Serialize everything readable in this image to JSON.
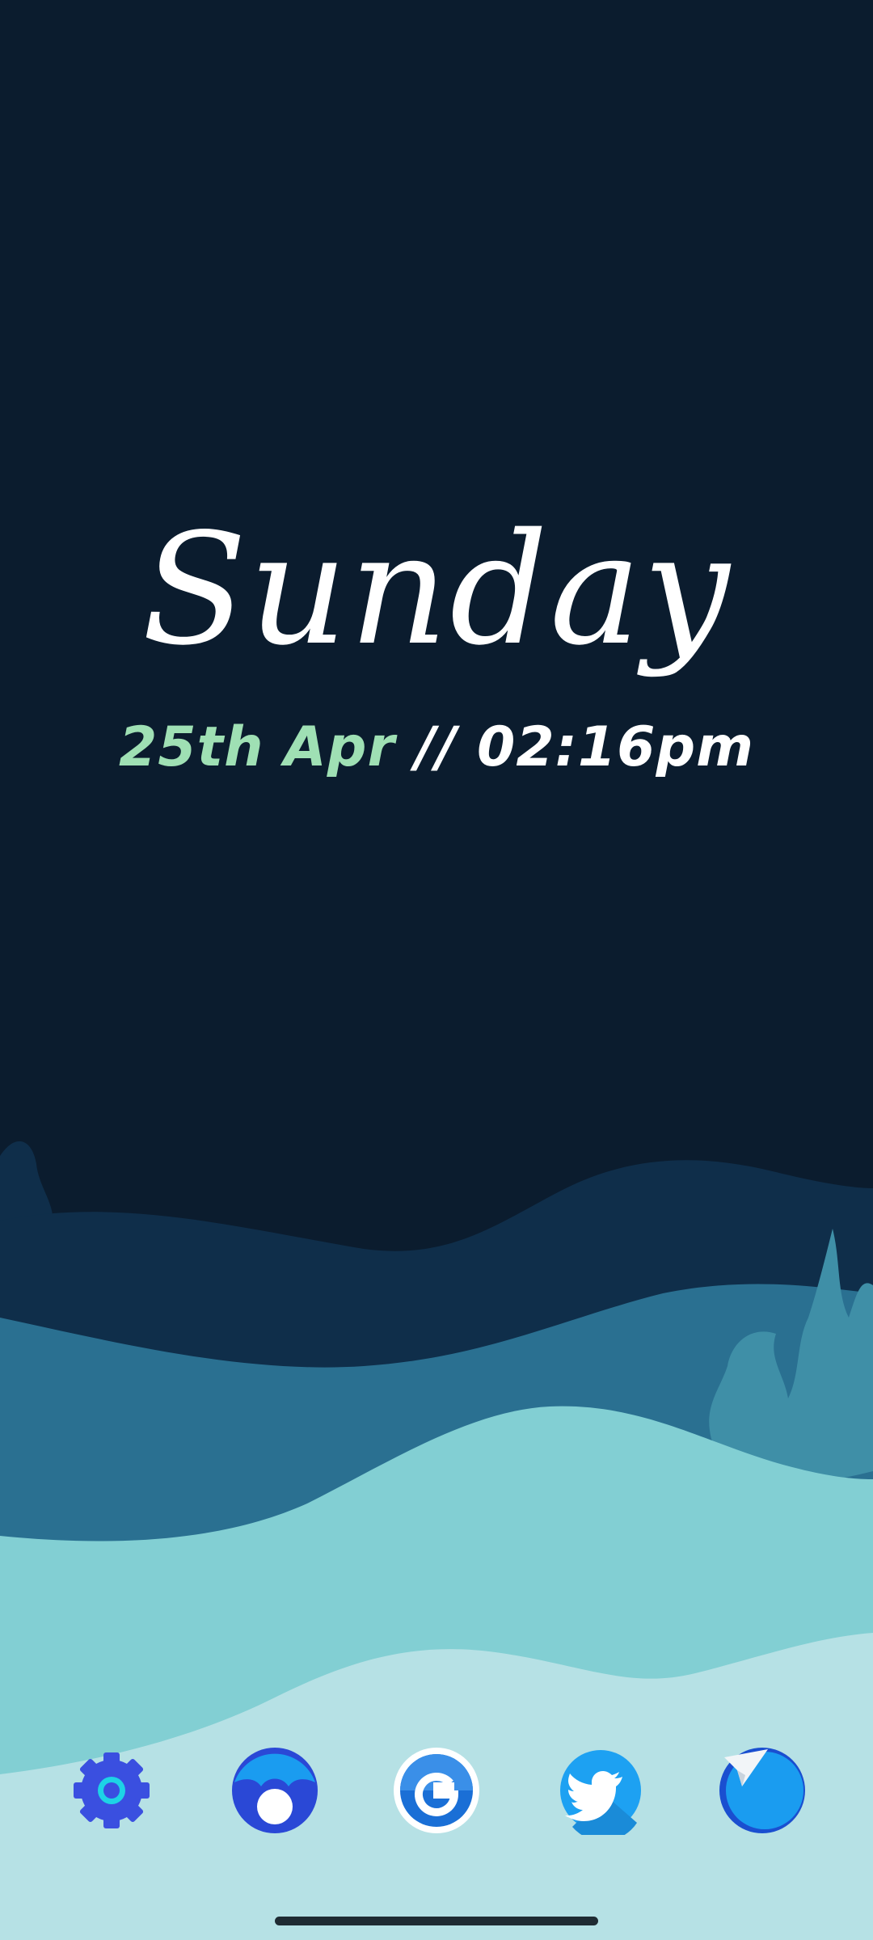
{
  "widget": {
    "day": "Sunday",
    "date": "25th Apr",
    "separator": " // ",
    "time": "02:16pm"
  },
  "dock": {
    "apps": [
      {
        "icon": "settings-gear-icon"
      },
      {
        "icon": "camera-icon"
      },
      {
        "icon": "google-icon"
      },
      {
        "icon": "twitter-bird-icon"
      },
      {
        "icon": "telegram-icon"
      }
    ]
  },
  "colors": {
    "sky": "#0b1c2e",
    "wave_dark": "#0f2e4a",
    "wave_mid": "#2a7091",
    "wave_light": "#82cfd3",
    "wave_lightest": "#b6e1e5",
    "date_accent": "#9fe0b4"
  }
}
